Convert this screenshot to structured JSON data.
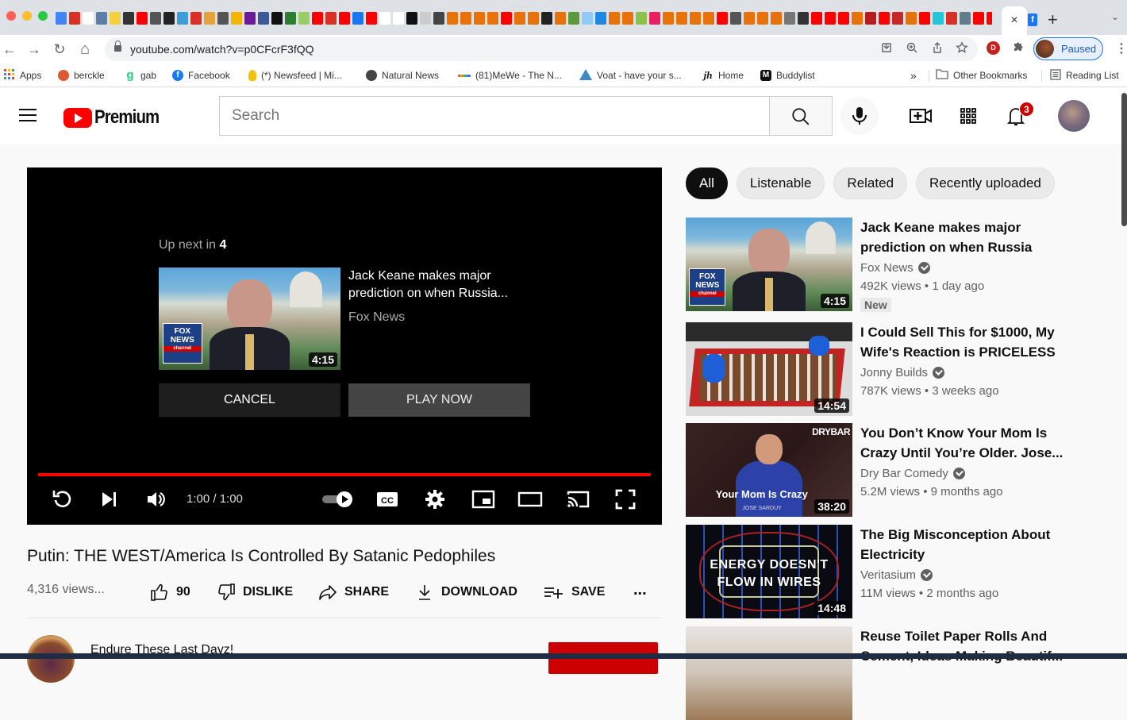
{
  "browser": {
    "tab_favicon_colors": [
      "#4285f4",
      "#d93025",
      "#ffffff",
      "#5b7fa7",
      "#f4d03f",
      "#333333",
      "#ff0000",
      "#555555",
      "#222222",
      "#3c9dd8",
      "#d93025",
      "#e6a23c",
      "#555555",
      "#f4b400",
      "#6a1b9a",
      "#3c5a99",
      "#111111",
      "#2e7d32",
      "#9ccc65",
      "#ff0000",
      "#d93025",
      "#ff0000",
      "#1877f2",
      "#ff0000",
      "#ffffff",
      "#ffffff",
      "#111111",
      "#cccccc",
      "#444444",
      "#e8710a",
      "#e8710a",
      "#e8710a",
      "#e8710a",
      "#ff0000",
      "#e8710a",
      "#e8710a",
      "#222222",
      "#e8710a",
      "#5a9a3c",
      "#90caf9",
      "#1e88e5",
      "#e8710a",
      "#e8710a",
      "#8bc34a",
      "#e91e63",
      "#e8710a",
      "#e8710a",
      "#e8710a",
      "#e8710a",
      "#ff0000",
      "#555555",
      "#e8710a",
      "#e8710a",
      "#e8710a",
      "#777777",
      "#333333",
      "#ff0000",
      "#ff0000",
      "#ff0000",
      "#e8710a",
      "#b71c1c",
      "#ff0000",
      "#c62828",
      "#e8710a",
      "#ff0000",
      "#26c6da",
      "#d93025",
      "#607d8b",
      "#ff0000",
      "#ff0000",
      "#4285f4",
      "#8bc34a",
      "#333333",
      "#26c6da",
      "#b71c1c",
      "#333333",
      "#26c6da",
      "#1565c0",
      "#26c6da"
    ],
    "active_tab_close": "×",
    "next_tab_favicon": "f",
    "new_tab": "+",
    "tab_list": "⌄",
    "nav": {
      "back": "←",
      "forward": "→",
      "reload": "↻",
      "home": "⌂"
    },
    "url": "youtube.com/watch?v=p0CFcrF3fQQ",
    "extension_badge": "D",
    "profile_status": "Paused",
    "menu": "⋮",
    "bookmarks": [
      {
        "label": "Apps",
        "icon": "apps-grid-icon",
        "color": "#ea4335"
      },
      {
        "label": "berckle",
        "icon": "duckduckgo-icon",
        "color": "#de5833"
      },
      {
        "label": "gab",
        "icon": "gab-icon",
        "color": "#21cf7a"
      },
      {
        "label": "Facebook",
        "icon": "facebook-icon",
        "color": "#1877f2"
      },
      {
        "label": "(*) Newsfeed | Mi...",
        "icon": "lightbulb-icon",
        "color": "#f4c20d"
      },
      {
        "label": "Natural News",
        "icon": "globe-icon",
        "color": "#444444"
      },
      {
        "label": "(81)MeWe - The N...",
        "icon": "mewe-icon",
        "color": "#7b61ff"
      },
      {
        "label": "Voat - have your s...",
        "icon": "voat-icon",
        "color": "#3f88c5"
      },
      {
        "label": "Home",
        "icon": "jh-icon",
        "color": "#111111"
      },
      {
        "label": "Buddylist",
        "icon": "buddylist-icon",
        "color": "#111111"
      }
    ],
    "bookmarks_overflow": "»",
    "other_bookmarks": "Other Bookmarks",
    "reading_list": "Reading List"
  },
  "youtube": {
    "logo_text": "Premium",
    "search_placeholder": "Search",
    "notification_count": "3",
    "player": {
      "upnext_prefix": "Up next in",
      "upnext_countdown": "4",
      "upnext_title": "Jack Keane makes major prediction on when Russia...",
      "upnext_channel": "Fox News",
      "upnext_duration": "4:15",
      "cancel_label": "CANCEL",
      "play_now_label": "PLAY NOW",
      "time_display": "1:00 / 1:00",
      "progress_fraction": 1.0,
      "autoplay_on": true,
      "accent": "#ff0000"
    },
    "video": {
      "title": "Putin: THE WEST/America Is Controlled By Satanic Pedophiles",
      "views": "4,316 views...",
      "likes": "90",
      "dislike_label": "DISLIKE",
      "share_label": "SHARE",
      "download_label": "DOWNLOAD",
      "save_label": "SAVE",
      "more": "..."
    },
    "owner": {
      "name": "Endure These Last Dayz!"
    },
    "chips": [
      "All",
      "Listenable",
      "Related",
      "Recently uploaded"
    ],
    "recommendations": [
      {
        "title": "Jack Keane makes major prediction on when Russia will...",
        "channel": "Fox News",
        "views": "492K views",
        "age": "1 day ago",
        "duration": "4:15",
        "badge": "New"
      },
      {
        "title": "I Could Sell This for $1000, My Wife's Reaction is PRICELESS",
        "channel": "Jonny Builds",
        "views": "787K views",
        "age": "3 weeks ago",
        "duration": "14:54"
      },
      {
        "title": "You Don’t Know Your Mom Is Crazy Until You’re Older. Jose...",
        "channel": "Dry Bar Comedy",
        "views": "5.2M views",
        "age": "9 months ago",
        "duration": "38:20",
        "thumb_brand": "DRYBAR",
        "thumb_caption": "Your Mom Is Crazy",
        "thumb_subcaption": "JOSE SARDUY"
      },
      {
        "title": "The Big Misconception About Electricity",
        "channel": "Veritasium",
        "views": "11M views",
        "age": "2 months ago",
        "duration": "14:48",
        "thumb_text_1": "ENERGY DOESN'T",
        "thumb_text_2": "FLOW IN WIRES"
      },
      {
        "title": "Reuse Toilet Paper Rolls And Cement, Ideas Making Beautif..."
      }
    ]
  }
}
